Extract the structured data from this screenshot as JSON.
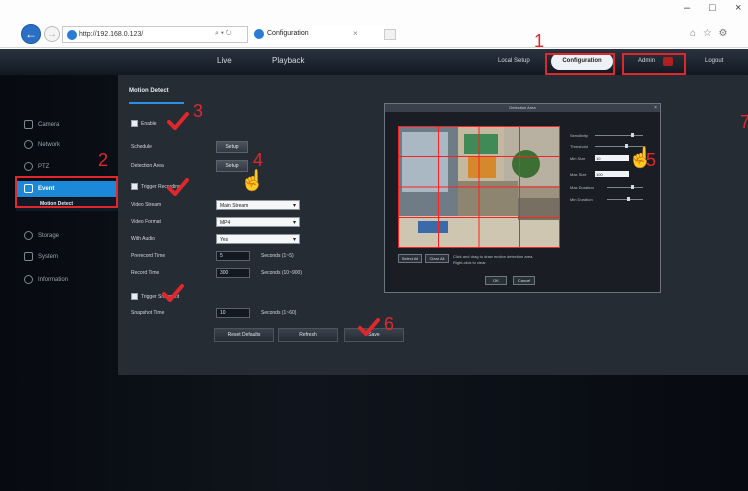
{
  "browser": {
    "url": "http://192.168.0.123/",
    "address_tools": "⌕ ▾ ↻",
    "tab_title": "Configuration",
    "back_glyph": "←",
    "forward_glyph": "→",
    "tab_close": "×",
    "window_controls": {
      "minimize": "–",
      "maximize": "□",
      "close": "×"
    },
    "toolbar_icons": "⌂ ☆ ⚙"
  },
  "app_nav": {
    "live": "Live",
    "playback": "Playback",
    "local_setup": "Local Setup",
    "configuration": "Configuration",
    "admin": "Admin",
    "logout": "Logout"
  },
  "sidebar": {
    "items": {
      "camera": "Camera",
      "network": "Network",
      "ptz": "PTZ",
      "event": "Event",
      "motion_detect": "Motion Detect",
      "storage": "Storage",
      "system": "System",
      "information": "Information"
    }
  },
  "panel": {
    "title": "Motion Detect",
    "enable_label": "Enable",
    "schedule_label": "Schedule",
    "schedule_btn": "Setup",
    "detection_area_label": "Detection Area",
    "detection_area_btn": "Setup",
    "trigger_recording_label": "Trigger Recording",
    "video_stream_label": "Video Stream",
    "video_stream_value": "Main Stream",
    "video_format_label": "Video Format",
    "video_format_value": "MP4",
    "with_audio_label": "With Audio",
    "with_audio_value": "Yes",
    "prerecord_label": "Prerecord Time",
    "prerecord_value": "5",
    "prerecord_unit": "Seconds (1~5)",
    "record_time_label": "Record Time",
    "record_time_value": "300",
    "record_time_unit": "Seconds (10~900)",
    "trigger_snapshot_label": "Trigger Snapshot",
    "snapshot_time_label": "Snapshot Time",
    "snapshot_time_value": "10",
    "snapshot_time_unit": "Seconds (1~60)",
    "reset_btn": "Reset Defaults",
    "refresh_btn": "Refresh",
    "save_btn": "Save"
  },
  "md_dialog": {
    "title": "Detection Area",
    "sensitivity": "Sensitivity",
    "threshold": "Threshold",
    "min_size": "Min Size",
    "max_size": "Max Size",
    "min_size_value": "10",
    "max_size_value": "100",
    "max_duration": "Max Duration",
    "min_duration": "Min Duration",
    "select_all": "Select All",
    "clear_all": "Clear All",
    "hint_line1": "Click and drag to draw motion detection area.",
    "hint_line2": "Right-click to clear.",
    "ok": "OK",
    "cancel": "Cancel",
    "close_glyph": "×"
  },
  "annotations": {
    "n1": "1",
    "n2": "2",
    "n3": "3",
    "n4": "4",
    "n5": "5",
    "n6": "6",
    "n7": "7"
  },
  "colors": {
    "accent_blue": "#1b88d8",
    "annotation_red": "#e0282c",
    "panel_bg": "#262c34"
  }
}
